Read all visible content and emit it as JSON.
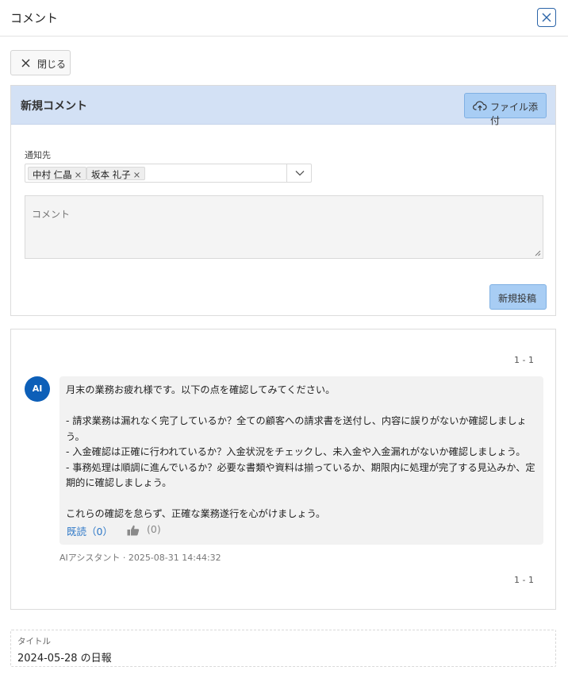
{
  "header": {
    "title": "コメント"
  },
  "toolbar": {
    "close_label": "閉じる"
  },
  "new_comment": {
    "title": "新規コメント",
    "attach_label": "ファイル添付",
    "notify_label": "通知先",
    "recipients": [
      "中村 仁晶",
      "坂本 礼子"
    ],
    "remove_glyph": "×",
    "comment_placeholder": "コメント",
    "post_label": "新規投稿"
  },
  "comments": {
    "pager_top": "1 - 1",
    "pager_bottom": "1 - 1",
    "items": [
      {
        "avatar": "AI",
        "text": "月末の業務お疲れ様です。以下の点を確認してみてください。\n\n- 請求業務は漏れなく完了しているか？全ての顧客への請求書を送付し、内容に誤りがないか確認しましょう。\n- 入金確認は正確に行われているか？入金状況をチェックし、未入金や入金漏れがないか確認しましょう。\n- 事務処理は順調に進んでいるか？必要な書類や資料は揃っているか、期限内に処理が完了する見込みか、定期的に確認しましょう。\n\nこれらの確認を怠らず、正確な業務遂行を心がけましょう。",
        "read_label": "既読（0）",
        "like_count": "(0)",
        "meta": "AIアシスタント · 2025-08-31 14:44:32"
      }
    ]
  },
  "title_field": {
    "label": "タイトル",
    "value": "2024-05-28 の日報"
  },
  "colors": {
    "accent": "#2b64a8",
    "header_band": "#d3e1f5",
    "primary_button": "#a8cdf4",
    "avatar": "#0d5fb8",
    "link": "#2e78c7"
  }
}
